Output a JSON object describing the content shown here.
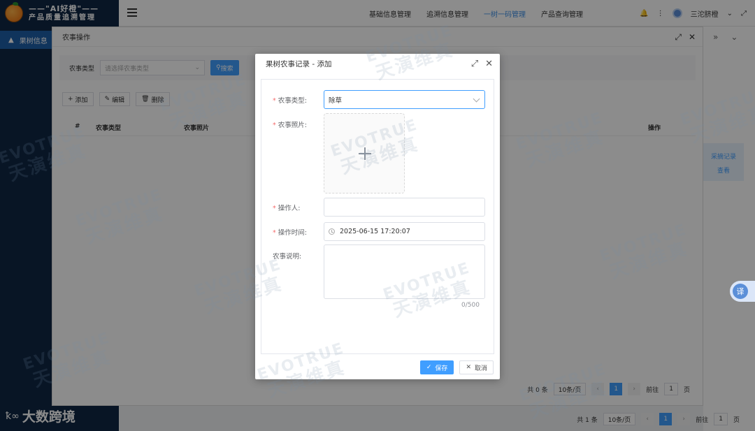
{
  "app": {
    "logo_line1": "——\"AI好橙\"——",
    "logo_line2": "产品质量追溯管理"
  },
  "topnav": {
    "items": [
      "基础信息管理",
      "追溯信息管理",
      "一树一码管理",
      "产品查询管理"
    ],
    "active_index": 2,
    "user_name": "三沱脐橙"
  },
  "sidebar": {
    "items": [
      {
        "label": "果树信息"
      }
    ]
  },
  "window": {
    "title": "农事操作",
    "filter_label": "农事类型",
    "filter_placeholder": "请选择农事类型",
    "search_button": "搜索",
    "toolbar": {
      "add": "添加",
      "edit": "编辑",
      "delete": "删除"
    },
    "columns": [
      "#",
      "农事类型",
      "农事照片",
      "操作"
    ],
    "pager": {
      "total": "共 0 条",
      "page_size": "10条/页",
      "current": "1",
      "goto_label": "前往",
      "goto_value": "1",
      "page_unit": "页"
    }
  },
  "right_panel": {
    "record_link": "采摘记录",
    "view_link": "查看",
    "pager": {
      "total": "共 1 条",
      "page_size": "10条/页",
      "current": "1",
      "goto_label": "前往",
      "goto_value": "1",
      "page_unit": "页"
    },
    "translate_label": "译"
  },
  "dialog": {
    "title": "果树农事记录 - 添加",
    "fields": {
      "type_label": "农事类型:",
      "type_value": "除草",
      "photo_label": "农事照片:",
      "operator_label": "操作人:",
      "operator_value": "",
      "time_label": "操作时间:",
      "time_value": "2025-06-15 17:20:07",
      "desc_label": "农事说明:",
      "desc_counter": "0/500"
    },
    "save_label": "保存",
    "cancel_label": "取消"
  },
  "watermark": {
    "en": "EVOTRUE",
    "cn": "天演维真"
  },
  "footer_brand": {
    "text": "大数跨境"
  },
  "colors": {
    "primary": "#409eff",
    "sidebar_bg": "#0f2744",
    "required": "#f56c6c"
  }
}
